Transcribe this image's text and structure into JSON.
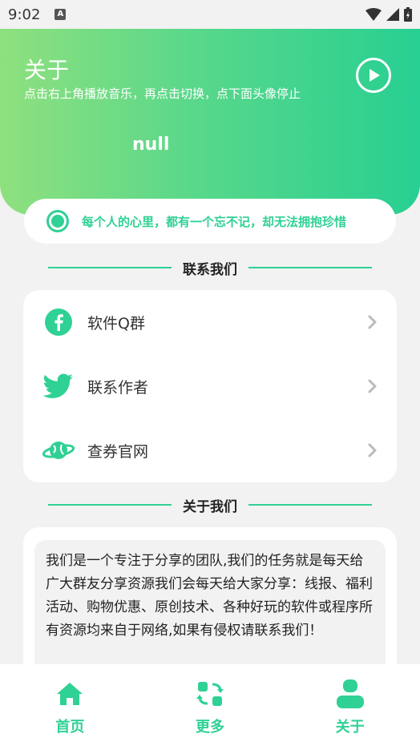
{
  "status_bar": {
    "time": "9:02",
    "notification_letter": "A"
  },
  "header": {
    "title": "关于",
    "subtitle": "点击右上角播放音乐，再点击切换，点下面头像停止",
    "username": "null"
  },
  "marquee": {
    "text": "每个人的心里，都有一个忘不记，却无法拥抱珍惜"
  },
  "contact_section": {
    "heading": "联系我们",
    "items": [
      {
        "label": "软件Q群",
        "icon": "facebook-icon"
      },
      {
        "label": "联系作者",
        "icon": "twitter-icon"
      },
      {
        "label": "查券官网",
        "icon": "planet-icon"
      }
    ]
  },
  "about_section": {
    "heading": "关于我们",
    "text": "我们是一个专注于分享的团队,我们的任务就是每天给广大群友分享资源我们会每天给大家分享：线报、福利活动、购物优惠、原创技术、各种好玩的软件或程序所有资源均来自于网络,如果有侵权请联系我们！"
  },
  "bottom_nav": {
    "items": [
      {
        "label": "首页",
        "icon": "home-icon"
      },
      {
        "label": "更多",
        "icon": "refresh-grid-icon"
      },
      {
        "label": "关于",
        "icon": "person-icon"
      }
    ]
  },
  "colors": {
    "accent": "#2fd194",
    "gradient_start": "#8fe07e",
    "gradient_end": "#27cf92"
  }
}
